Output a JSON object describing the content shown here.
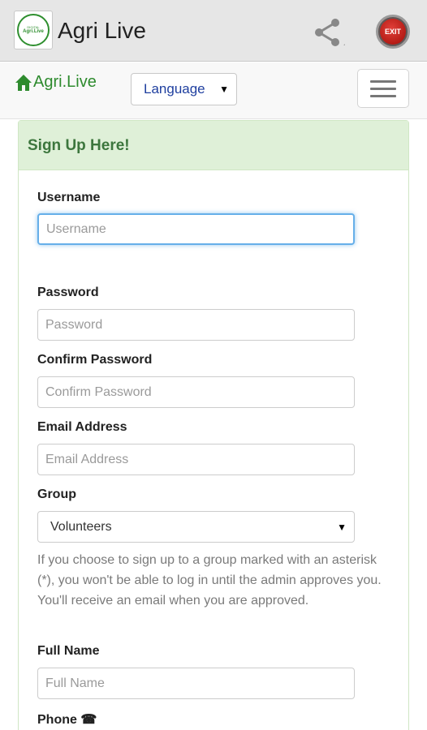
{
  "app_bar": {
    "title": "Agri Live",
    "logo_text_small": "DIGITAL",
    "logo_text": "Agri.Live",
    "exit_label": "EXIT",
    "share_icon": "share-icon"
  },
  "navbar": {
    "brand": "Agri.Live",
    "brand_icon": "home-icon",
    "language_select": "Language"
  },
  "form": {
    "heading": "Sign Up Here!",
    "username_label": "Username",
    "username_placeholder": "Username",
    "password_label": "Password",
    "password_placeholder": "Password",
    "confirm_label": "Confirm Password",
    "confirm_placeholder": "Confirm Password",
    "email_label": "Email Address",
    "email_placeholder": "Email Address",
    "group_label": "Group",
    "group_value": "Volunteers",
    "group_help": "If you choose to sign up to a group marked with an asterisk (*), you won't be able to log in until the admin approves you. You'll receive an email when you are approved.",
    "fullname_label": "Full Name",
    "fullname_placeholder": "Full Name",
    "phone_label": "Phone ☎"
  },
  "colors": {
    "brand_green": "#2e8b2e",
    "heading_bg": "#dff0d8",
    "heading_text": "#3c763d",
    "focus_border": "#66afe9"
  }
}
